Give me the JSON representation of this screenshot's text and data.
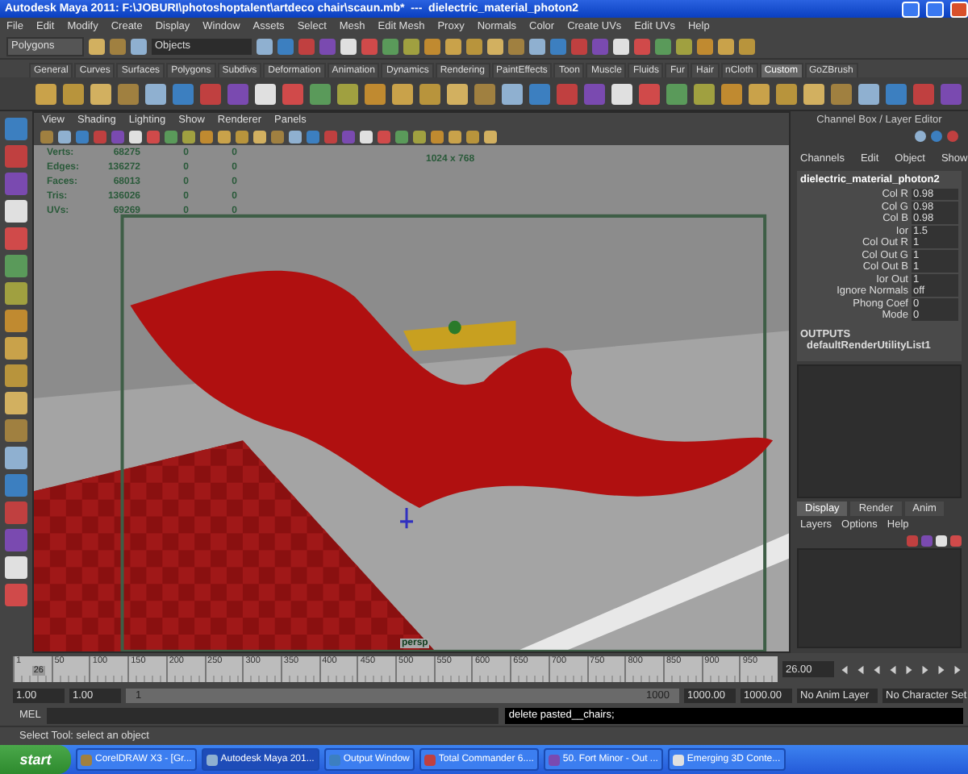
{
  "window": {
    "title": "Autodesk Maya 2011: F:\\JOBURI\\photoshoptalent\\artdeco chair\\scaun.mb*  ---  dielectric_material_photon2"
  },
  "menu": [
    "File",
    "Edit",
    "Modify",
    "Create",
    "Display",
    "Window",
    "Assets",
    "Select",
    "Mesh",
    "Edit Mesh",
    "Proxy",
    "Normals",
    "Color",
    "Create UVs",
    "Edit UVs",
    "Help"
  ],
  "status_line": {
    "menu_set": "Polygons",
    "selection_field": "Objects"
  },
  "shelf": {
    "tabs": [
      {
        "label": "General",
        "selected": false
      },
      {
        "label": "Curves",
        "selected": false
      },
      {
        "label": "Surfaces",
        "selected": false
      },
      {
        "label": "Polygons",
        "selected": false
      },
      {
        "label": "Subdivs",
        "selected": false
      },
      {
        "label": "Deformation",
        "selected": false
      },
      {
        "label": "Animation",
        "selected": false
      },
      {
        "label": "Dynamics",
        "selected": false
      },
      {
        "label": "Rendering",
        "selected": false
      },
      {
        "label": "PaintEffects",
        "selected": false
      },
      {
        "label": "Toon",
        "selected": false
      },
      {
        "label": "Muscle",
        "selected": false
      },
      {
        "label": "Fluids",
        "selected": false
      },
      {
        "label": "Fur",
        "selected": false
      },
      {
        "label": "Hair",
        "selected": false
      },
      {
        "label": "nCloth",
        "selected": false
      },
      {
        "label": "Custom",
        "selected": true
      },
      {
        "label": "GoZBrush",
        "selected": false
      }
    ]
  },
  "viewport": {
    "menu": [
      "View",
      "Shading",
      "Lighting",
      "Show",
      "Renderer",
      "Panels"
    ],
    "stats": [
      {
        "label": "Verts:",
        "values": [
          "68275",
          "0",
          "0"
        ]
      },
      {
        "label": "Edges:",
        "values": [
          "136272",
          "0",
          "0"
        ]
      },
      {
        "label": "Faces:",
        "values": [
          "68013",
          "0",
          "0"
        ]
      },
      {
        "label": "Tris:",
        "values": [
          "136026",
          "0",
          "0"
        ]
      },
      {
        "label": "UVs:",
        "values": [
          "69269",
          "0",
          "0"
        ]
      }
    ],
    "resolution": "1024 x 768",
    "camera": "persp"
  },
  "channel_box": {
    "title": "Channel Box / Layer Editor",
    "menu": [
      "Channels",
      "Edit",
      "Object",
      "Show"
    ],
    "node": "dielectric_material_photon2",
    "attributes": [
      {
        "name": "Col R",
        "value": "0.98"
      },
      {
        "name": "Col G",
        "value": "0.98"
      },
      {
        "name": "Col B",
        "value": "0.98"
      },
      {
        "name": "Ior",
        "value": "1.5"
      },
      {
        "name": "Col Out R",
        "value": "1"
      },
      {
        "name": "Col Out G",
        "value": "1"
      },
      {
        "name": "Col Out B",
        "value": "1"
      },
      {
        "name": "Ior Out",
        "value": "1"
      },
      {
        "name": "Ignore Normals",
        "value": "off"
      },
      {
        "name": "Phong Coef",
        "value": "0"
      },
      {
        "name": "Mode",
        "value": "0"
      }
    ],
    "outputs_heading": "OUTPUTS",
    "outputs": [
      "defaultRenderUtilityList1"
    ]
  },
  "layer_editor": {
    "tabs": [
      {
        "label": "Display",
        "selected": true
      },
      {
        "label": "Render",
        "selected": false
      },
      {
        "label": "Anim",
        "selected": false
      }
    ],
    "menu": [
      "Layers",
      "Options",
      "Help"
    ]
  },
  "timeline": {
    "ticks": [
      "1",
      "50",
      "100",
      "150",
      "200",
      "250",
      "300",
      "350",
      "400",
      "450",
      "500",
      "550",
      "600",
      "650",
      "700",
      "750",
      "800",
      "850",
      "900",
      "950"
    ],
    "current_frame": "26",
    "current_time": "26.00",
    "level": 0.025
  },
  "range": {
    "start": "1.00",
    "playback_start": "1.00",
    "slider_start": "1",
    "slider_end": "1000",
    "level": 1,
    "playback_end": "1000.00",
    "end": "1000.00",
    "anim_layer": "No Anim Layer",
    "character_set": "No Character Set"
  },
  "command_line": {
    "label": "MEL",
    "result": "delete pasted__chairs;"
  },
  "help_line": "Select Tool: select an object",
  "taskbar": {
    "start": "start",
    "items": [
      {
        "label": "CorelDRAW X3 - [Gr...",
        "selected": false
      },
      {
        "label": "Autodesk Maya 201...",
        "selected": true
      },
      {
        "label": "Output Window",
        "selected": false
      },
      {
        "label": "Total Commander 6....",
        "selected": false
      },
      {
        "label": "50. Fort Minor - Out ...",
        "selected": false
      },
      {
        "label": "Emerging 3D Conte...",
        "selected": false
      }
    ]
  }
}
